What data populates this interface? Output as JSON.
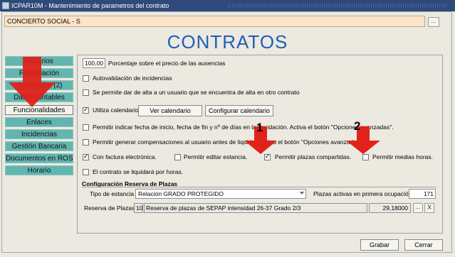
{
  "window": {
    "title": "ICPAR10M - Mantenimiento de parametros del contrato"
  },
  "contract": {
    "value": "CONCIERTO SOCIAL - S",
    "dots": "..."
  },
  "heading": "CONTRATOS",
  "nav": [
    {
      "label": "Usuarios",
      "active": false
    },
    {
      "label": "Financiación",
      "active": false
    },
    {
      "label": "Tarificación (2)",
      "active": false
    },
    {
      "label": "Datos contables",
      "active": false
    },
    {
      "label": "Funcionalidades",
      "active": true
    },
    {
      "label": "Enlaces",
      "active": false
    },
    {
      "label": "Incidencias",
      "active": false
    },
    {
      "label": "Gestión Bancaria",
      "active": false
    },
    {
      "label": "Documentos en ROSA",
      "active": false
    },
    {
      "label": "Horario",
      "active": false
    }
  ],
  "options": {
    "percentage_value": "100,00",
    "percentage_label": "Porcentaje sobre el precio de las ausencias",
    "auto_validation": "Autovalidación de incidencias",
    "allow_registration": "Se permite dar de alta a un usuario que se encuentra de alta en otro contrato",
    "use_calendar": "Utiliza calendario",
    "view_calendar": "Ver calendario",
    "configure_calendar": "Configurar calendario",
    "allow_dates": "Permitir indicar fecha de inicio, fecha de fin y nº de días en la liquidación. Activa el botón \"Opciones avanzadas\".",
    "allow_compensations": "Permitir generar compensaciones al usuario antes de liquidar. Activa el botón \"Opciones avanzadas\".",
    "electronic_invoice": "Con factura electrónica.",
    "edit_stay": "Permitir editar estancia.",
    "shared_places": "Permitir plazas compartidas.",
    "half_hours": "Permitir medias horas.",
    "hourly_settlement": "El contrato se liquidará por horas."
  },
  "reserve": {
    "section_title": "Configuración Reserva de Plazas",
    "stay_type_label": "Tipo de estancia",
    "stay_type_value": "Relación GRADO PROTEGIDO",
    "active_places_label": "Plazas activas en primera ocupación",
    "active_places_value": "171",
    "reserve_label": "Reserva de Plazas",
    "reserve_code": "10",
    "reserve_desc": "Reserva de plazas de SEPAP intensidad 26-37 Grado 2/3",
    "reserve_amount": "29,18000",
    "dots": "...",
    "clear": "X"
  },
  "footer": {
    "save": "Grabar",
    "close": "Cerrar"
  },
  "annotations": {
    "one": "1",
    "two": "2"
  },
  "colors": {
    "title_blue": "#1f5fb8",
    "nav_teal": "#62b5b0",
    "arrow_red": "#e0221a",
    "contract_bg": "#fde4c8"
  }
}
